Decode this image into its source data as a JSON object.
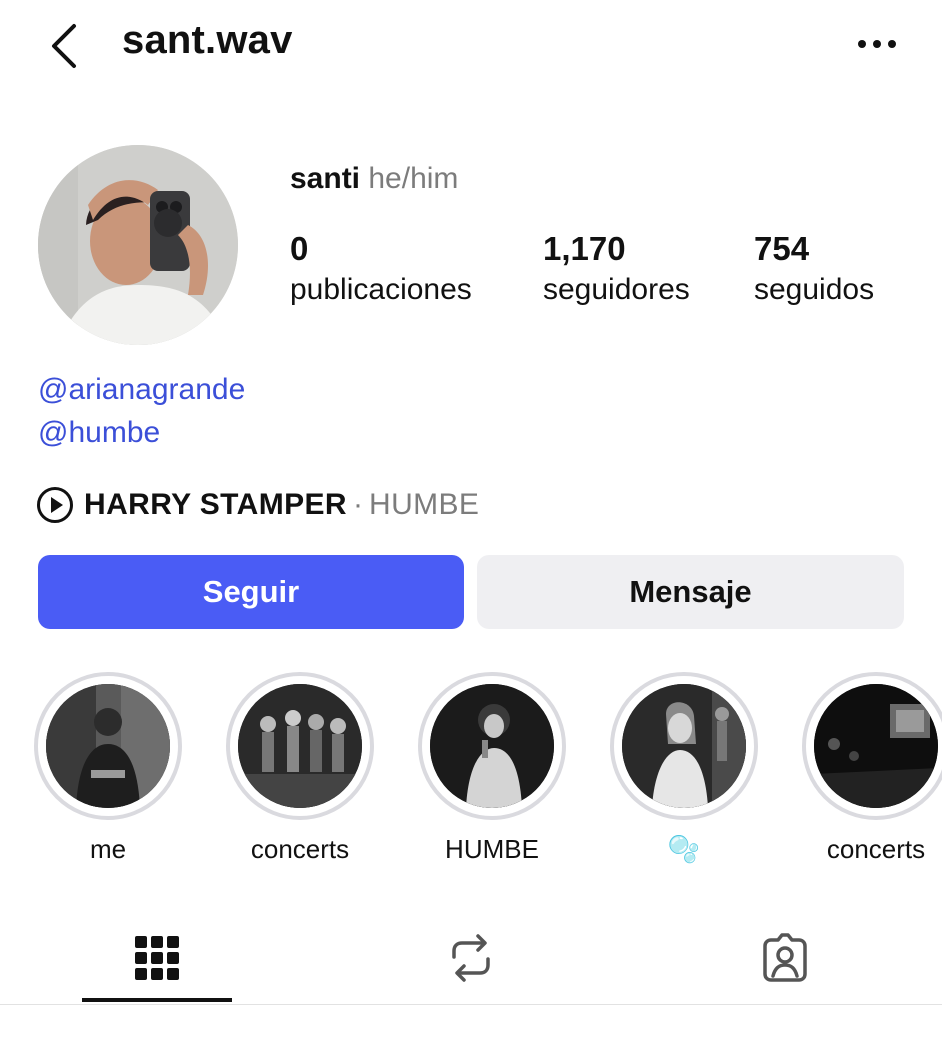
{
  "header": {
    "username": "sant.wav",
    "back_icon": "chevron-left-icon",
    "more_icon": "more-horizontal-icon"
  },
  "profile": {
    "name": "santi",
    "pronouns": "he/him",
    "stats": {
      "posts_value": "0",
      "posts_label": "publicaciones",
      "followers_value": "1,170",
      "followers_label": "seguidores",
      "following_value": "754",
      "following_label": "seguidos"
    },
    "bio_mentions": [
      "@arianagrande",
      "@humbe"
    ],
    "music": {
      "icon": "play-circle-icon",
      "title": "HARRY STAMPER",
      "separator": "·",
      "artist": "HUMBE"
    }
  },
  "actions": {
    "follow_label": "Seguir",
    "message_label": "Mensaje"
  },
  "highlights": [
    {
      "label": "me"
    },
    {
      "label": "concerts"
    },
    {
      "label": "HUMBE"
    },
    {
      "label": "🫧"
    },
    {
      "label": "concerts"
    }
  ],
  "tabs": {
    "grid_icon": "grid-icon",
    "reels_icon": "repost-icon",
    "tagged_icon": "tagged-person-icon",
    "active": "grid"
  },
  "colors": {
    "accent": "#4a5cf5",
    "link": "#3b4fd8",
    "muted_text": "#7c7c7c",
    "secondary_button": "#efeff2"
  }
}
